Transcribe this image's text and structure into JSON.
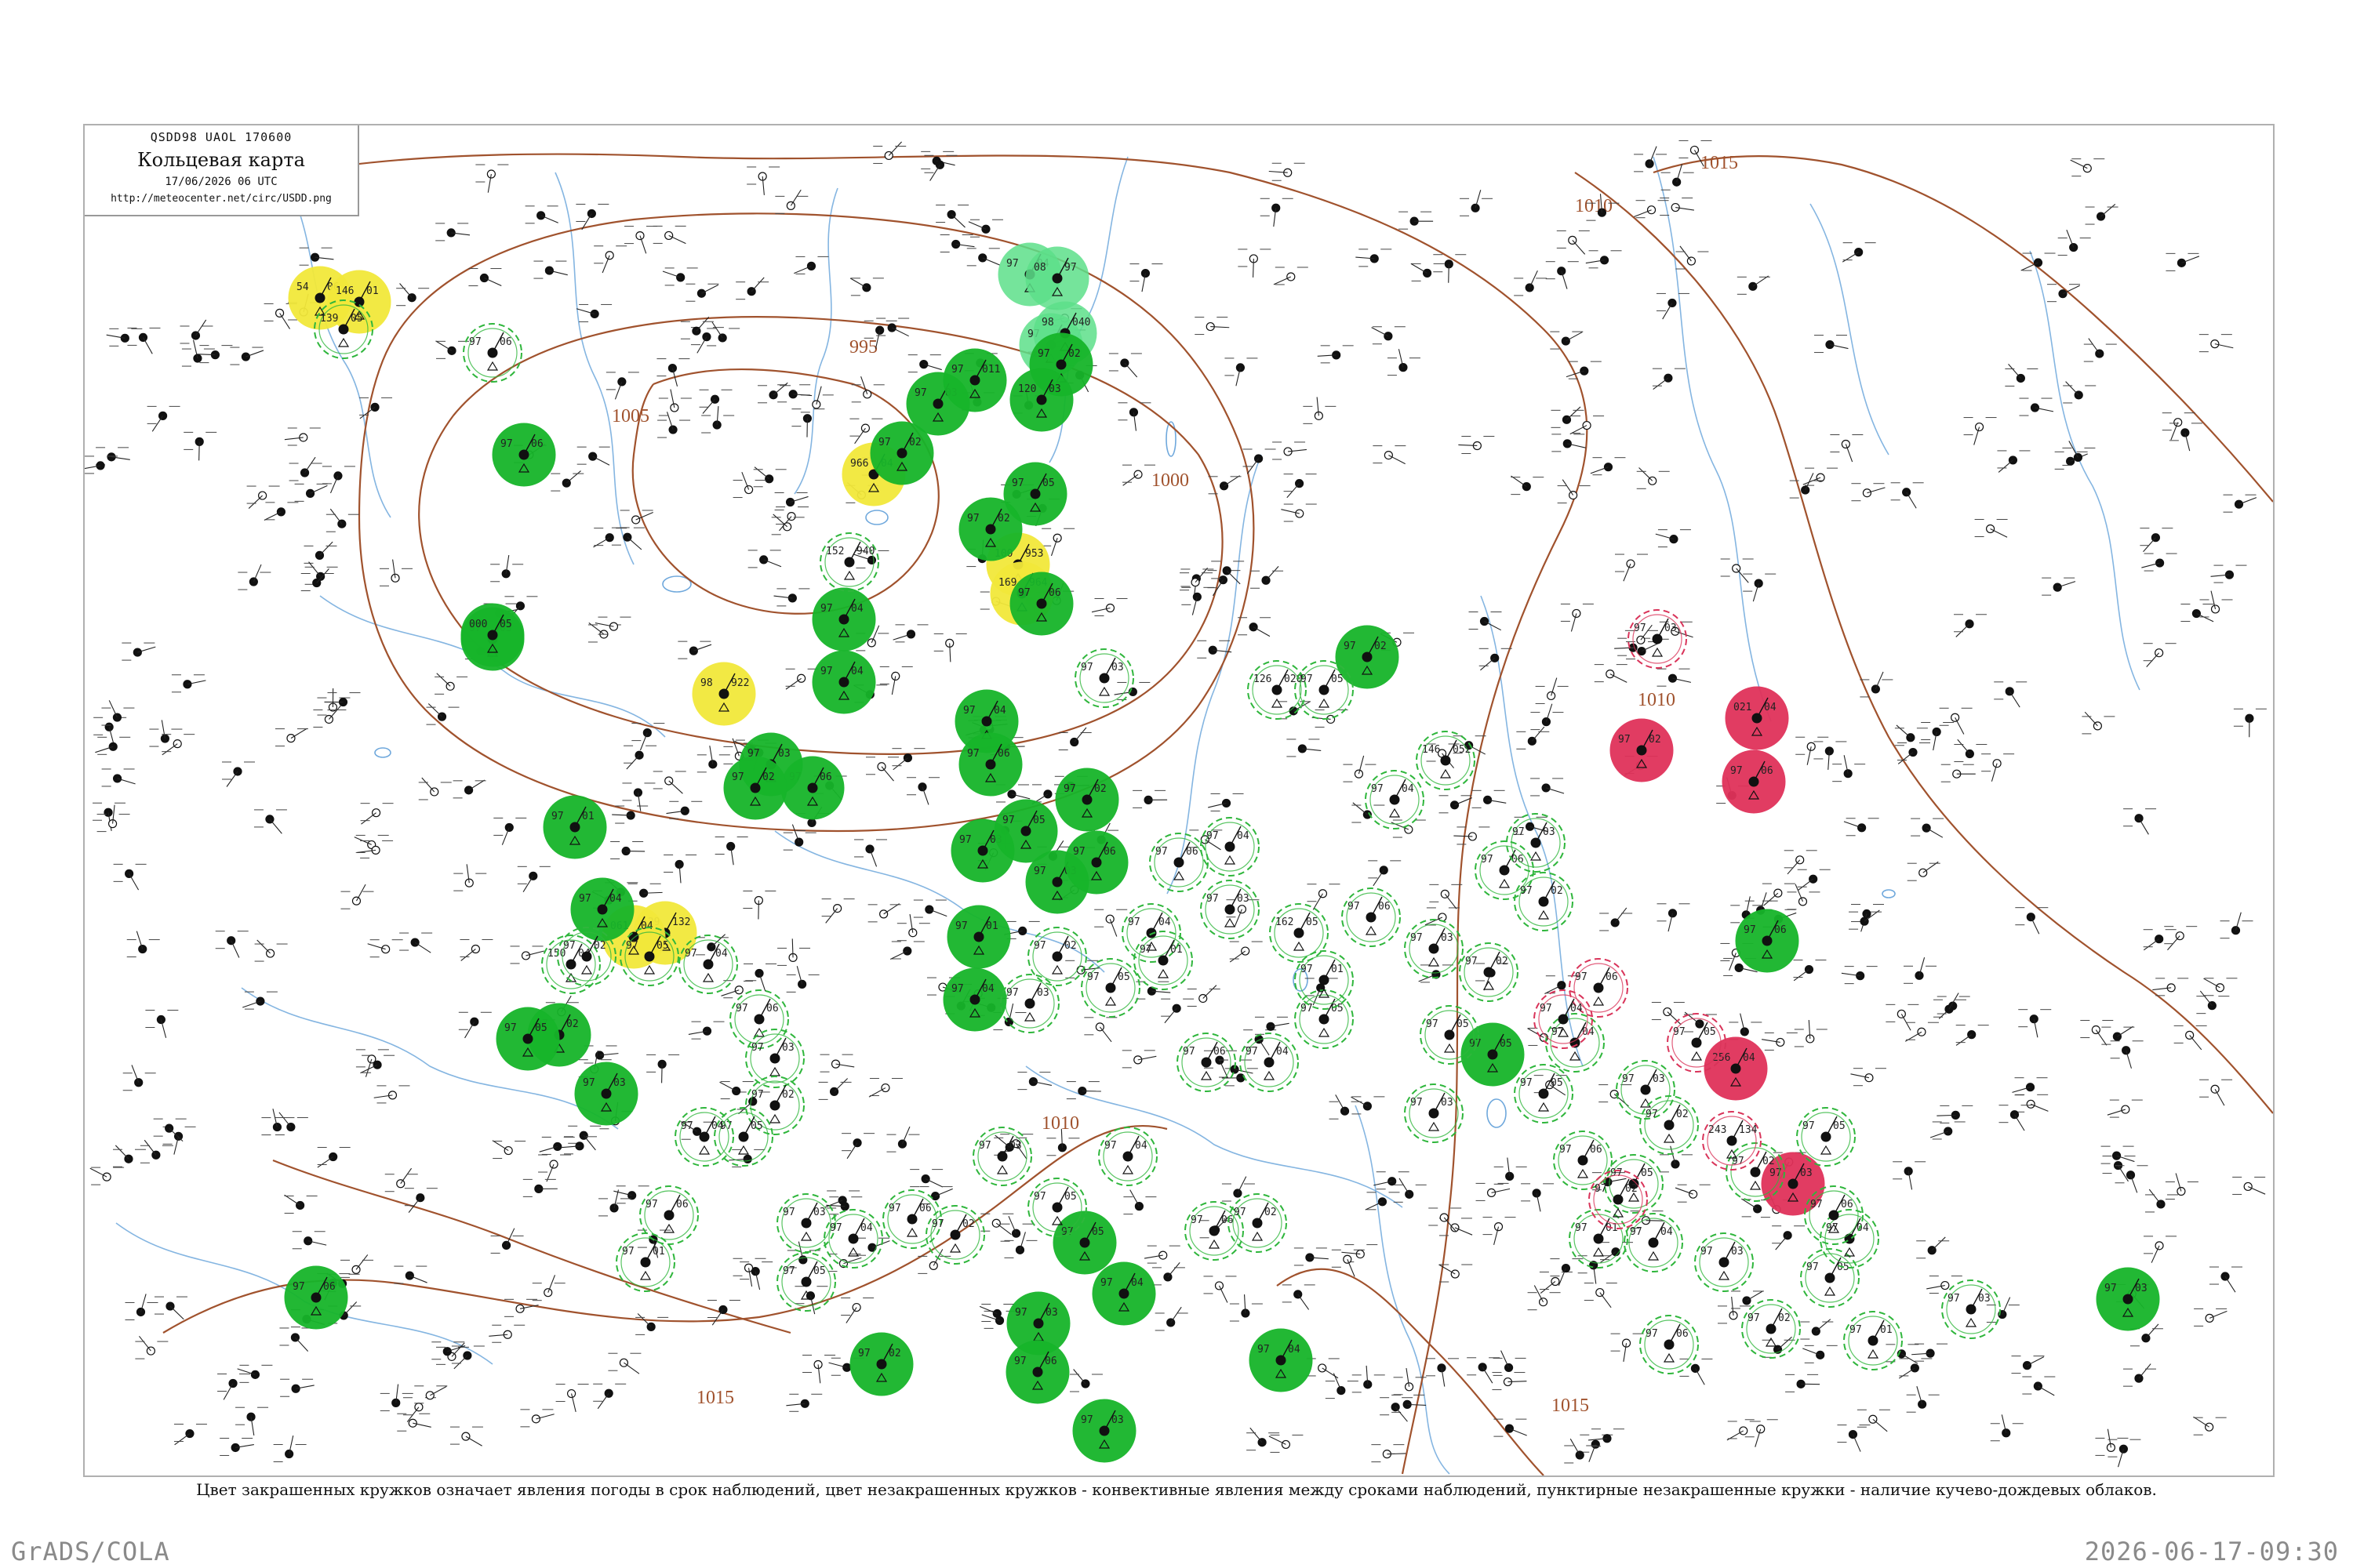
{
  "header": {
    "code": "QSDD98  UAOL  170600",
    "title": "Кольцевая карта",
    "date": "17/06/2026 06 UTC",
    "url": "http://meteocenter.net/circ/USDD.png"
  },
  "isobars": [
    {
      "label": "995"
    },
    {
      "label": "1000"
    },
    {
      "label": "1005"
    },
    {
      "label": "1010"
    },
    {
      "label": "1015"
    }
  ],
  "stations": [
    {
      "temp": "54",
      "code": "06",
      "category": "yellow",
      "dashed": false
    },
    {
      "temp": "146",
      "code": "01",
      "category": "yellow",
      "dashed": false
    },
    {
      "temp": "966",
      "code": "04",
      "category": "yellow",
      "dashed": false
    },
    {
      "temp": "100",
      "code": "953",
      "category": "yellow",
      "dashed": false
    },
    {
      "temp": "169",
      "code": "964",
      "category": "yellow",
      "dashed": false
    },
    {
      "temp": "98",
      "code": "922",
      "category": "yellow",
      "dashed": false
    },
    {
      "temp": "129",
      "code": "132",
      "category": "yellow",
      "dashed": false
    },
    {
      "temp": "061",
      "code": "04",
      "category": "yellow",
      "dashed": false
    },
    {
      "temp": "97",
      "code": "04",
      "category": "lightgreen",
      "dashed": false
    },
    {
      "temp": "08",
      "code": "97",
      "category": "lightgreen",
      "dashed": false
    },
    {
      "temp": "97",
      "code": "05",
      "category": "lightgreen",
      "dashed": false
    },
    {
      "temp": "98",
      "code": "040",
      "category": "lightgreen",
      "dashed": false
    },
    {
      "temp": "97",
      "code": "03",
      "category": "green",
      "dashed": false
    },
    {
      "temp": "97",
      "code": "06",
      "category": "green",
      "dashed": false
    },
    {
      "temp": "000",
      "code": "05",
      "category": "green",
      "dashed": false
    },
    {
      "temp": "97",
      "code": "02",
      "category": "green",
      "dashed": false
    },
    {
      "temp": "97",
      "code": "03",
      "category": "green",
      "dashed": false
    },
    {
      "temp": "97",
      "code": "011",
      "category": "green",
      "dashed": false
    },
    {
      "temp": "97",
      "code": "02",
      "category": "green",
      "dashed": false
    },
    {
      "temp": "120",
      "code": "03",
      "category": "green",
      "dashed": false
    },
    {
      "temp": "97",
      "code": "05",
      "category": "green",
      "dashed": false
    },
    {
      "temp": "97",
      "code": "06",
      "category": "green",
      "dashed": false
    },
    {
      "temp": "97",
      "code": "02",
      "category": "green",
      "dashed": false
    },
    {
      "temp": "97",
      "code": "04",
      "category": "green",
      "dashed": false
    },
    {
      "temp": "97",
      "code": "04",
      "category": "green",
      "dashed": false
    },
    {
      "temp": "97",
      "code": "06",
      "category": "green",
      "dashed": false
    },
    {
      "temp": "97",
      "code": "03",
      "category": "green",
      "dashed": false
    },
    {
      "temp": "97",
      "code": "02",
      "category": "green",
      "dashed": false
    },
    {
      "temp": "97",
      "code": "04",
      "category": "green",
      "dashed": false
    },
    {
      "temp": "97",
      "code": "06",
      "category": "green",
      "dashed": false
    },
    {
      "temp": "97",
      "code": "03",
      "category": "green",
      "dashed": false
    },
    {
      "temp": "97",
      "code": "05",
      "category": "green",
      "dashed": false
    },
    {
      "temp": "97",
      "code": "03",
      "category": "green",
      "dashed": false
    },
    {
      "temp": "97",
      "code": "01",
      "category": "green",
      "dashed": false
    },
    {
      "temp": "97",
      "code": "04",
      "category": "green",
      "dashed": false
    },
    {
      "temp": "97",
      "code": "02",
      "category": "green",
      "dashed": false
    },
    {
      "temp": "97",
      "code": "06",
      "category": "green",
      "dashed": false
    },
    {
      "temp": "97",
      "code": "03",
      "category": "green",
      "dashed": false
    },
    {
      "temp": "97",
      "code": "05",
      "category": "green",
      "dashed": false
    },
    {
      "temp": "97",
      "code": "06",
      "category": "green",
      "dashed": false
    },
    {
      "temp": "97",
      "code": "04",
      "category": "green",
      "dashed": false
    },
    {
      "temp": "97",
      "code": "02",
      "category": "green",
      "dashed": false
    },
    {
      "temp": "97",
      "code": "03",
      "category": "green",
      "dashed": false
    },
    {
      "temp": "97",
      "code": "05",
      "category": "green",
      "dashed": false
    },
    {
      "temp": "97",
      "code": "06",
      "category": "green",
      "dashed": false
    },
    {
      "temp": "97",
      "code": "01",
      "category": "green",
      "dashed": false
    },
    {
      "temp": "97",
      "code": "04",
      "category": "green",
      "dashed": false
    },
    {
      "temp": "97",
      "code": "02",
      "category": "green",
      "dashed": false
    },
    {
      "temp": "97",
      "code": "03",
      "category": "green",
      "dashed": false
    },
    {
      "temp": "97",
      "code": "05",
      "category": "green",
      "dashed": false
    },
    {
      "temp": "97",
      "code": "06",
      "category": "green",
      "dashed": false
    },
    {
      "temp": "97",
      "code": "04",
      "category": "green",
      "dashed": false
    },
    {
      "temp": "97",
      "code": "03",
      "category": "green",
      "dashed": false
    },
    {
      "temp": "97",
      "code": "02",
      "category": "green",
      "dashed": false
    },
    {
      "temp": "021",
      "code": "04",
      "category": "red",
      "dashed": false
    },
    {
      "temp": "97",
      "code": "02",
      "category": "red",
      "dashed": false
    },
    {
      "temp": "97",
      "code": "06",
      "category": "red",
      "dashed": false
    },
    {
      "temp": "256",
      "code": "04",
      "category": "red",
      "dashed": false
    },
    {
      "temp": "97",
      "code": "03",
      "category": "red",
      "dashed": false
    },
    {
      "temp": "139",
      "code": "05",
      "category": "green",
      "dashed": true
    },
    {
      "temp": "97",
      "code": "06",
      "category": "green",
      "dashed": true
    },
    {
      "temp": "150",
      "code": "04",
      "category": "green",
      "dashed": true
    },
    {
      "temp": "152",
      "code": "940",
      "category": "green",
      "dashed": true
    },
    {
      "temp": "97",
      "code": "03",
      "category": "green",
      "dashed": true
    },
    {
      "temp": "126",
      "code": "020",
      "category": "green",
      "dashed": true
    },
    {
      "temp": "97",
      "code": "05",
      "category": "green",
      "dashed": true
    },
    {
      "temp": "162",
      "code": "05",
      "category": "green",
      "dashed": true
    },
    {
      "temp": "97",
      "code": "04",
      "category": "green",
      "dashed": true
    },
    {
      "temp": "146",
      "code": "052",
      "category": "green",
      "dashed": true
    },
    {
      "temp": "97",
      "code": "06",
      "category": "green",
      "dashed": true
    },
    {
      "temp": "97",
      "code": "03",
      "category": "green",
      "dashed": true
    },
    {
      "temp": "97",
      "code": "02",
      "category": "green",
      "dashed": true
    },
    {
      "temp": "97",
      "code": "05",
      "category": "green",
      "dashed": true
    },
    {
      "temp": "97",
      "code": "04",
      "category": "green",
      "dashed": true
    },
    {
      "temp": "97",
      "code": "06",
      "category": "green",
      "dashed": true
    },
    {
      "temp": "97",
      "code": "01",
      "category": "green",
      "dashed": true
    },
    {
      "temp": "97",
      "code": "03",
      "category": "green",
      "dashed": true
    },
    {
      "temp": "97",
      "code": "02",
      "category": "green",
      "dashed": true
    },
    {
      "temp": "97",
      "code": "05",
      "category": "green",
      "dashed": true
    },
    {
      "temp": "97",
      "code": "04",
      "category": "green",
      "dashed": true
    },
    {
      "temp": "97",
      "code": "06",
      "category": "green",
      "dashed": true
    },
    {
      "temp": "97",
      "code": "03",
      "category": "green",
      "dashed": true
    },
    {
      "temp": "97",
      "code": "02",
      "category": "green",
      "dashed": true
    },
    {
      "temp": "97",
      "code": "05",
      "category": "green",
      "dashed": true
    },
    {
      "temp": "97",
      "code": "04",
      "category": "green",
      "dashed": true
    },
    {
      "temp": "97",
      "code": "06",
      "category": "green",
      "dashed": true
    },
    {
      "temp": "97",
      "code": "01",
      "category": "green",
      "dashed": true
    },
    {
      "temp": "97",
      "code": "03",
      "category": "green",
      "dashed": true
    },
    {
      "temp": "97",
      "code": "02",
      "category": "green",
      "dashed": true
    },
    {
      "temp": "97",
      "code": "05",
      "category": "green",
      "dashed": true
    },
    {
      "temp": "97",
      "code": "04",
      "category": "green",
      "dashed": true
    },
    {
      "temp": "97",
      "code": "06",
      "category": "green",
      "dashed": true
    },
    {
      "temp": "97",
      "code": "03",
      "category": "green",
      "dashed": true
    },
    {
      "temp": "97",
      "code": "02",
      "category": "green",
      "dashed": true
    },
    {
      "temp": "97",
      "code": "05",
      "category": "green",
      "dashed": true
    },
    {
      "temp": "97",
      "code": "04",
      "category": "green",
      "dashed": true
    },
    {
      "temp": "97",
      "code": "06",
      "category": "green",
      "dashed": true
    },
    {
      "temp": "97",
      "code": "01",
      "category": "green",
      "dashed": true
    },
    {
      "temp": "97",
      "code": "03",
      "category": "green",
      "dashed": true
    },
    {
      "temp": "97",
      "code": "05",
      "category": "green",
      "dashed": true
    },
    {
      "temp": "97",
      "code": "04",
      "category": "green",
      "dashed": true
    },
    {
      "temp": "97",
      "code": "06",
      "category": "green",
      "dashed": true
    },
    {
      "temp": "97",
      "code": "02",
      "category": "green",
      "dashed": true
    },
    {
      "temp": "97",
      "code": "03",
      "category": "green",
      "dashed": true
    },
    {
      "temp": "97",
      "code": "05",
      "category": "green",
      "dashed": true
    },
    {
      "temp": "97",
      "code": "04",
      "category": "green",
      "dashed": true
    },
    {
      "temp": "97",
      "code": "06",
      "category": "green",
      "dashed": true
    },
    {
      "temp": "97",
      "code": "02",
      "category": "green",
      "dashed": true
    },
    {
      "temp": "97",
      "code": "03",
      "category": "green",
      "dashed": true
    },
    {
      "temp": "97",
      "code": "05",
      "category": "green",
      "dashed": true
    },
    {
      "temp": "97",
      "code": "04",
      "category": "green",
      "dashed": true
    },
    {
      "temp": "97",
      "code": "06",
      "category": "green",
      "dashed": true
    },
    {
      "temp": "97",
      "code": "01",
      "category": "green",
      "dashed": true
    },
    {
      "temp": "97",
      "code": "03",
      "category": "green",
      "dashed": true
    },
    {
      "temp": "97",
      "code": "02",
      "category": "green",
      "dashed": true
    },
    {
      "temp": "97",
      "code": "05",
      "category": "green",
      "dashed": true
    },
    {
      "temp": "97",
      "code": "04",
      "category": "green",
      "dashed": true
    },
    {
      "temp": "97",
      "code": "06",
      "category": "green",
      "dashed": true
    },
    {
      "temp": "97",
      "code": "03",
      "category": "green",
      "dashed": true
    },
    {
      "temp": "97",
      "code": "02",
      "category": "green",
      "dashed": true
    },
    {
      "temp": "97",
      "code": "05",
      "category": "green",
      "dashed": true
    },
    {
      "temp": "97",
      "code": "04",
      "category": "green",
      "dashed": true
    },
    {
      "temp": "97",
      "code": "06",
      "category": "green",
      "dashed": true
    },
    {
      "temp": "97",
      "code": "01",
      "category": "green",
      "dashed": true
    },
    {
      "temp": "97",
      "code": "03",
      "category": "green",
      "dashed": true
    },
    {
      "temp": "97",
      "code": "02",
      "category": "green",
      "dashed": true
    },
    {
      "temp": "97",
      "code": "05",
      "category": "green",
      "dashed": true
    },
    {
      "temp": "243",
      "code": "134",
      "category": "red",
      "dashed": true
    },
    {
      "temp": "97",
      "code": "05",
      "category": "red",
      "dashed": true
    },
    {
      "temp": "97",
      "code": "06",
      "category": "red",
      "dashed": true
    },
    {
      "temp": "97",
      "code": "04",
      "category": "red",
      "dashed": true
    },
    {
      "temp": "97",
      "code": "03",
      "category": "red",
      "dashed": true
    },
    {
      "temp": "97",
      "code": "02",
      "category": "red",
      "dashed": true
    }
  ],
  "caption": "Цвет закрашенных кружков означает явления погоды в срок наблюдений, цвет незакрашенных кружков - конвективные явления между сроками наблюдений, пунктирные незакрашенные кружки - наличие кучево-дождевых облаков.",
  "footer": {
    "left": "GrADS/COLA",
    "right": "2026-06-17-09:30"
  },
  "colors": {
    "isobar": "#a0522d",
    "water": "#6fa8dc",
    "station_text": "#222222",
    "green_fill": "#17b52a",
    "lightgreen_fill": "#5de08a",
    "yellow_fill": "#f2e83a",
    "red_fill": "#e0325a",
    "dashed_green": "#2fb63c",
    "dashed_red": "#d9345a"
  }
}
